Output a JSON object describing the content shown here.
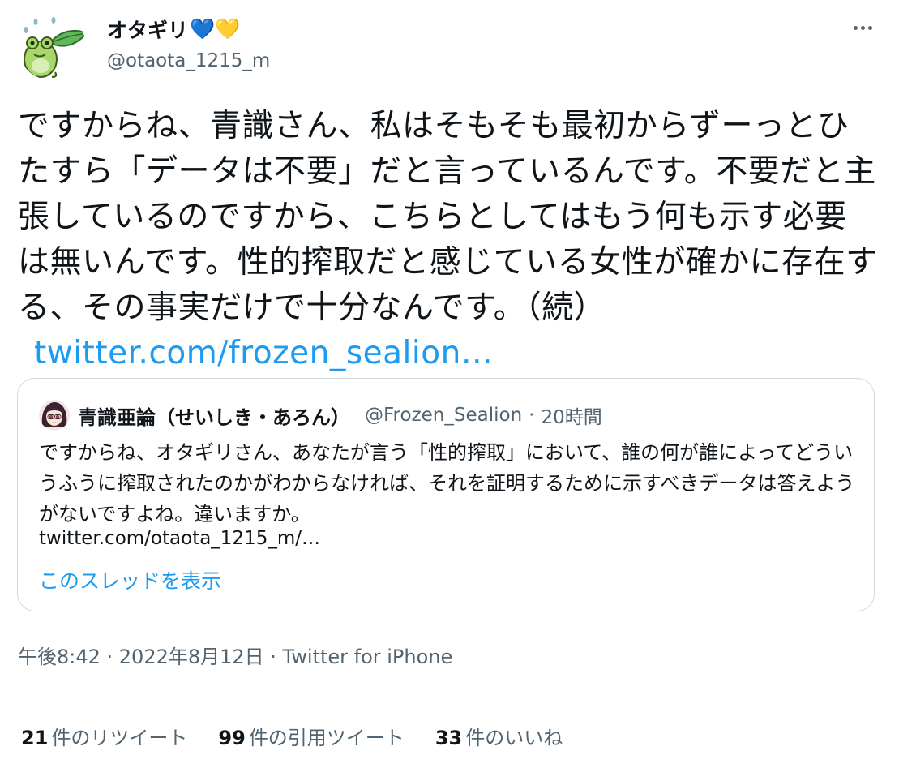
{
  "author": {
    "display_name": "オタギリ",
    "name_emoji": "💙💛",
    "handle": "@otaota_1215_m",
    "avatar_icon": "frog-with-leaf-icon"
  },
  "tweet": {
    "text": "ですからね、青識さん、私はそもそも最初からずーっとひたすら「データは不要」だと言っているんです。不要だと主張しているのですから、こちらとしてはもう何も示す必要は無いんです。性的搾取だと感じている女性が確かに存在する、その事実だけで十分なんです。（続）",
    "link": "twitter.com/frozen_sealion…"
  },
  "quoted": {
    "display_name": "青識亜論（せいしき・あろん）",
    "handle": "@Frozen_Sealion",
    "separator": "·",
    "time": "20時間",
    "text": "ですからね、オタギリさん、あなたが言う「性的搾取」において、誰の何が誰によってどういうふうに搾取されたのかがわからなければ、それを証明するために示すべきデータは答えようがないですよね。違いますか。",
    "link": "twitter.com/otaota_1215_m/…",
    "show_thread": "このスレッドを表示"
  },
  "meta": {
    "timestamp": "午後8:42 · 2022年8月12日 · Twitter for iPhone"
  },
  "stats": {
    "retweets_count": "21",
    "retweets_label": "件のリツイート",
    "quotes_count": "99",
    "quotes_label": "件の引用ツイート",
    "likes_count": "33",
    "likes_label": "件のいいね"
  },
  "colors": {
    "link": "#1d9bf0",
    "secondary_text": "#536471",
    "border": "#cfd9de"
  }
}
